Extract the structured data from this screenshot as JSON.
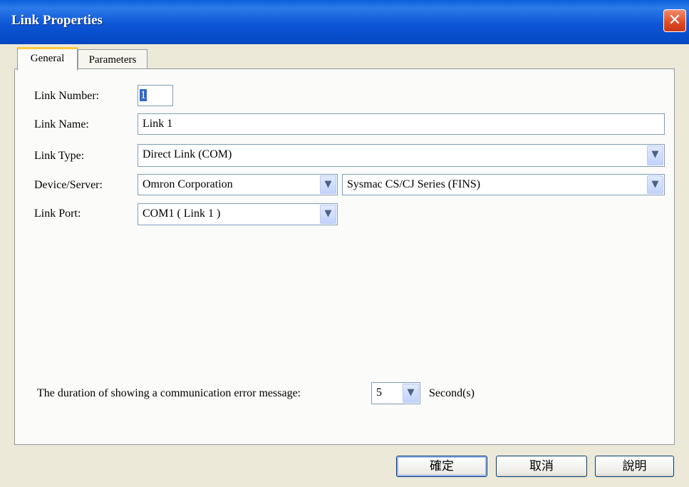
{
  "window": {
    "title": "Link Properties"
  },
  "tabs": [
    {
      "label": "General",
      "active": true
    },
    {
      "label": "Parameters",
      "active": false
    }
  ],
  "form": {
    "link_number_label": "Link Number:",
    "link_number_value": "1",
    "link_name_label": "Link Name:",
    "link_name_value": "Link 1",
    "link_type_label": "Link Type:",
    "link_type_value": "Direct Link (COM)",
    "device_server_label": "Device/Server:",
    "device_vendor_value": "Omron Corporation",
    "device_model_value": "Sysmac CS/CJ Series (FINS)",
    "link_port_label": "Link Port:",
    "link_port_value": "COM1 ( Link 1 )"
  },
  "error_duration": {
    "label": "The duration of showing a communication error message:",
    "value": "5",
    "unit": "Second(s)"
  },
  "buttons": {
    "ok": "確定",
    "cancel": "取消",
    "help": "說明"
  },
  "icons": {
    "close": "close-icon",
    "dropdown": "chevron-down-icon"
  },
  "colors": {
    "title_bar": "#0a5fd8",
    "close_button": "#e04a23",
    "tab_highlight": "#ffc73c",
    "dialog_bg": "#ece9d8"
  }
}
